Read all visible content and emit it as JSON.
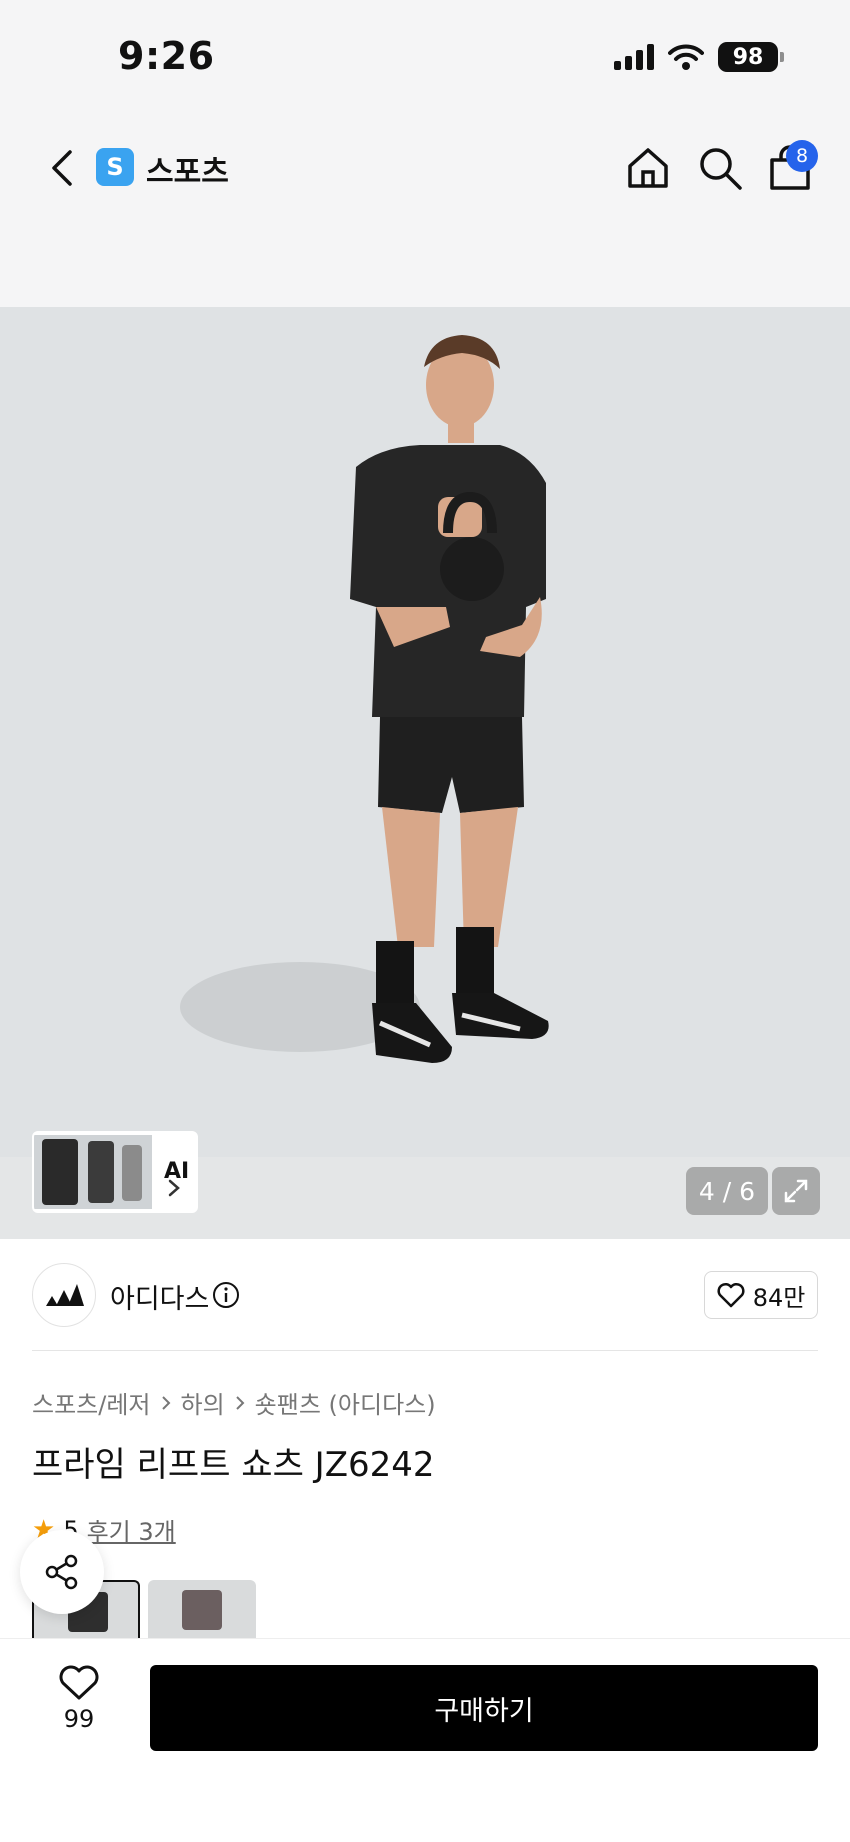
{
  "status": {
    "time": "9:26",
    "battery": "98"
  },
  "nav": {
    "brand_badge": "S",
    "title": "스포츠",
    "cart_count": "8"
  },
  "gallery": {
    "ai_label": "AI",
    "page": "4 / 6"
  },
  "brand": {
    "name": "아디다스",
    "likes": "84만"
  },
  "breadcrumb": [
    "스포츠/레저",
    "하의",
    "숏팬츠 (아디다스)"
  ],
  "product": {
    "title": "프라임 리프트 쇼츠 JZ6242",
    "rating": "5",
    "reviews": "후기 3개"
  },
  "bottom": {
    "wish_count": "99",
    "buy_label": "구매하기"
  },
  "icons": [
    "back-icon",
    "home-icon",
    "search-icon",
    "cart-icon",
    "chevron-right-icon",
    "expand-icon",
    "info-icon",
    "heart-icon",
    "share-icon",
    "star-icon"
  ],
  "colors": {
    "accent": "#2563eb",
    "brand_badge": "#3aa3f0",
    "star": "#f59e0b",
    "buy_button": "#000000"
  }
}
